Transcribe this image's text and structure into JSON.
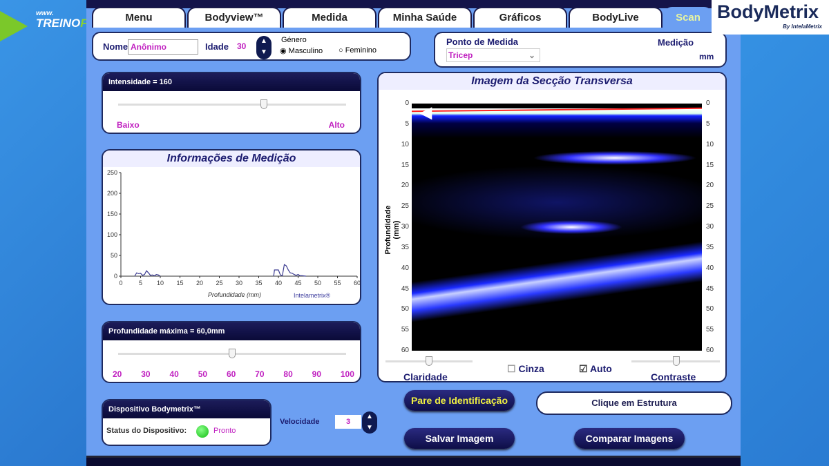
{
  "branding": {
    "watermark_site": "www.TREINOemFOCO.com.br",
    "logo": "BodyMetrix",
    "logo_sub": "By IntelaMetrix"
  },
  "tabs": [
    {
      "label": "Menu"
    },
    {
      "label": "Bodyview™"
    },
    {
      "label": "Medida"
    },
    {
      "label": "Minha Saúde"
    },
    {
      "label": "Gráficos"
    },
    {
      "label": "BodyLive"
    },
    {
      "label": "Scan",
      "active": true
    }
  ],
  "profile": {
    "name_label": "Nome",
    "name_value": "Anônimo",
    "age_label": "Idade",
    "age_value": "30",
    "gender_label": "Género",
    "gender_options": [
      {
        "label": "Masculino",
        "selected": true
      },
      {
        "label": "Feminino",
        "selected": false
      }
    ]
  },
  "measure": {
    "point_label": "Ponto de Medida",
    "point_value": "Tricep",
    "measurement_label": "Medição",
    "unit": "mm"
  },
  "intensity": {
    "title": "Intensidade = 160",
    "low": "Baixo",
    "high": "Alto",
    "value": 160,
    "fraction": 0.64
  },
  "info": {
    "title": "Informações de Medição"
  },
  "chart_data": {
    "type": "line",
    "xlabel": "Profundidade (mm)",
    "credit": "Intelametrix®",
    "xlim": [
      0,
      60
    ],
    "ylim": [
      0,
      250
    ],
    "xticks": [
      0,
      5,
      10,
      15,
      20,
      25,
      30,
      35,
      40,
      45,
      50,
      55,
      60
    ],
    "yticks": [
      0,
      50,
      100,
      150,
      200,
      250
    ],
    "x": [
      3.5,
      4,
      4.5,
      5,
      5.5,
      6,
      6.5,
      7,
      7.5,
      8,
      8.5,
      9,
      9.5,
      10,
      38.8,
      39,
      40,
      40.5,
      41,
      41.5,
      42,
      42.5,
      43,
      43.5,
      44,
      44.5,
      45,
      45.5,
      46,
      47
    ],
    "y": [
      0,
      8,
      6,
      7,
      2,
      4,
      13,
      8,
      2,
      3,
      1,
      4,
      3,
      0,
      0,
      15,
      15,
      3,
      1,
      28,
      25,
      15,
      8,
      7,
      4,
      2,
      4,
      1,
      1,
      0
    ]
  },
  "depth": {
    "title": "Profundidade máxima = 60,0mm",
    "scale": [
      "20",
      "30",
      "40",
      "50",
      "60",
      "70",
      "80",
      "90",
      "100"
    ],
    "value": 60
  },
  "device": {
    "title": "Dispositivo Bodymetrix™",
    "status_label": "Status do Dispositivo:",
    "status_value": "Pronto",
    "status_color": "#22cc22"
  },
  "speed": {
    "label": "Velocidade",
    "value": "3"
  },
  "scan": {
    "title": "Imagem da Secção Transversa",
    "ylabel": "Profundidade (mm)",
    "ticks": [
      "0",
      "5",
      "10",
      "15",
      "20",
      "25",
      "30",
      "35",
      "40",
      "45",
      "50",
      "55",
      "60"
    ],
    "clarity_label": "Claridade",
    "contrast_label": "Contraste",
    "gray_label": "Cinza",
    "gray_checked": false,
    "auto_label": "Auto",
    "auto_checked": true
  },
  "buttons": {
    "identify": "Pare de Identificação",
    "hint": "Clique em Estrutura",
    "save": "Salvar Imagem",
    "compare": "Comparar Imagens"
  }
}
